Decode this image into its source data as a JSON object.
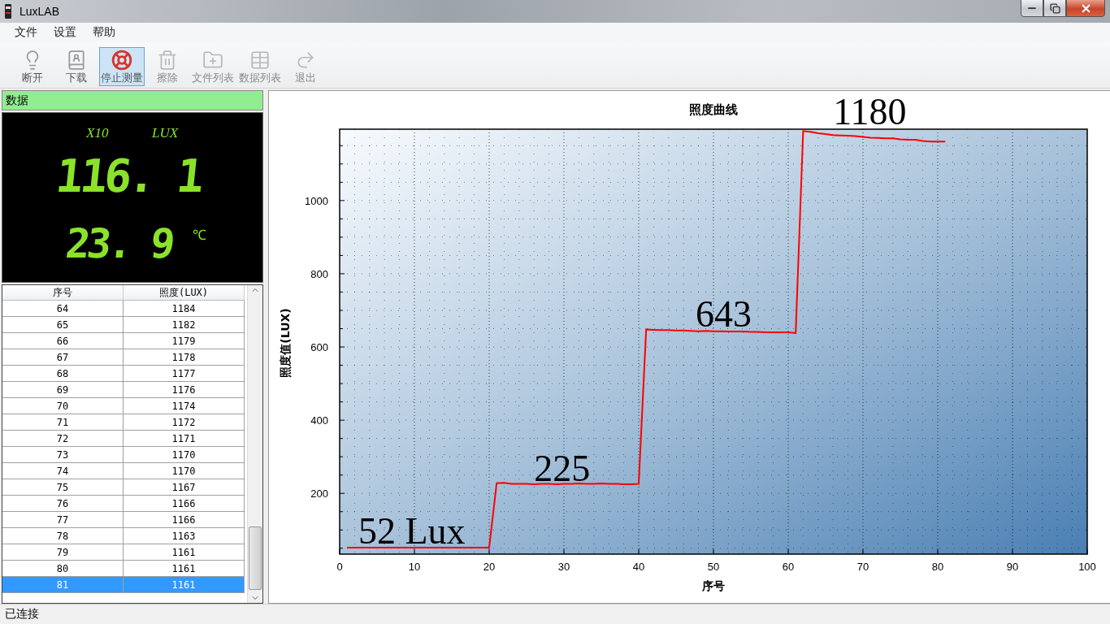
{
  "window": {
    "title": "LuxLAB"
  },
  "menu": [
    "文件",
    "设置",
    "帮助"
  ],
  "toolbar": [
    {
      "label": "断开",
      "kind": "bulb",
      "selected": false,
      "disabled": false
    },
    {
      "label": "下载",
      "kind": "book",
      "selected": false,
      "disabled": false
    },
    {
      "label": "停止测量",
      "kind": "lifebuoy",
      "selected": true,
      "disabled": false
    },
    {
      "label": "擦除",
      "kind": "trash",
      "selected": false,
      "disabled": true
    },
    {
      "label": "文件列表",
      "kind": "folder",
      "selected": false,
      "disabled": true
    },
    {
      "label": "数据列表",
      "kind": "table",
      "selected": false,
      "disabled": true
    },
    {
      "label": "退出",
      "kind": "exit",
      "selected": false,
      "disabled": true
    }
  ],
  "data_panel": {
    "title": "数据",
    "multiplier": "X10",
    "unit": "LUX",
    "lux_reading": "116. 1",
    "temperature": "23. 9",
    "temp_unit": "℃"
  },
  "table": {
    "columns": [
      "序号",
      "照度(LUX)"
    ],
    "rows": [
      {
        "cells": [
          "64",
          "1184"
        ],
        "selected": false
      },
      {
        "cells": [
          "65",
          "1182"
        ],
        "selected": false
      },
      {
        "cells": [
          "66",
          "1179"
        ],
        "selected": false
      },
      {
        "cells": [
          "67",
          "1178"
        ],
        "selected": false
      },
      {
        "cells": [
          "68",
          "1177"
        ],
        "selected": false
      },
      {
        "cells": [
          "69",
          "1176"
        ],
        "selected": false
      },
      {
        "cells": [
          "70",
          "1174"
        ],
        "selected": false
      },
      {
        "cells": [
          "71",
          "1172"
        ],
        "selected": false
      },
      {
        "cells": [
          "72",
          "1171"
        ],
        "selected": false
      },
      {
        "cells": [
          "73",
          "1170"
        ],
        "selected": false
      },
      {
        "cells": [
          "74",
          "1170"
        ],
        "selected": false
      },
      {
        "cells": [
          "75",
          "1167"
        ],
        "selected": false
      },
      {
        "cells": [
          "76",
          "1166"
        ],
        "selected": false
      },
      {
        "cells": [
          "77",
          "1166"
        ],
        "selected": false
      },
      {
        "cells": [
          "78",
          "1163"
        ],
        "selected": false
      },
      {
        "cells": [
          "79",
          "1161"
        ],
        "selected": false
      },
      {
        "cells": [
          "80",
          "1161"
        ],
        "selected": false
      },
      {
        "cells": [
          "81",
          "1161"
        ],
        "selected": true
      }
    ]
  },
  "chart": {
    "chart_data": {
      "type": "line",
      "title": "照度曲线",
      "xlabel": "序号",
      "ylabel": "照度值(LUX)",
      "xlim": [
        0,
        100
      ],
      "ylim": [
        34,
        1195
      ],
      "xticks": [
        0,
        10,
        20,
        30,
        40,
        50,
        60,
        70,
        80,
        90,
        100
      ],
      "yticks": [
        200,
        400,
        600,
        800,
        1000
      ],
      "x": [
        1,
        2,
        3,
        4,
        5,
        6,
        7,
        8,
        9,
        10,
        11,
        12,
        13,
        14,
        15,
        16,
        17,
        18,
        19,
        20,
        21,
        22,
        23,
        24,
        25,
        26,
        27,
        28,
        29,
        30,
        31,
        32,
        33,
        34,
        35,
        36,
        37,
        38,
        39,
        40,
        41,
        42,
        43,
        44,
        45,
        46,
        47,
        48,
        49,
        50,
        51,
        52,
        53,
        54,
        55,
        56,
        57,
        58,
        59,
        60,
        61,
        62,
        63,
        64,
        65,
        66,
        67,
        68,
        69,
        70,
        71,
        72,
        73,
        74,
        75,
        76,
        77,
        78,
        79,
        80,
        81
      ],
      "series": [
        {
          "color": "#ff0000",
          "values": [
            52,
            52,
            52,
            52,
            52,
            52,
            52,
            52,
            52,
            52,
            52,
            52,
            52,
            52,
            52,
            52,
            52,
            52,
            52,
            52,
            228,
            229,
            226,
            226,
            226,
            225,
            226,
            226,
            225,
            226,
            226,
            227,
            226,
            226,
            227,
            226,
            226,
            225,
            225,
            226,
            648,
            647,
            646,
            646,
            645,
            645,
            644,
            643,
            644,
            643,
            643,
            642,
            642,
            642,
            641,
            641,
            640,
            640,
            640,
            640,
            638,
            1190,
            1188,
            1184,
            1182,
            1179,
            1178,
            1177,
            1176,
            1174,
            1172,
            1171,
            1170,
            1170,
            1167,
            1166,
            1166,
            1163,
            1161,
            1161,
            1161
          ]
        }
      ],
      "grid": true,
      "annotations": [
        "52 Lux",
        "225",
        "643",
        "1180"
      ]
    }
  },
  "status_bar": "已连接"
}
